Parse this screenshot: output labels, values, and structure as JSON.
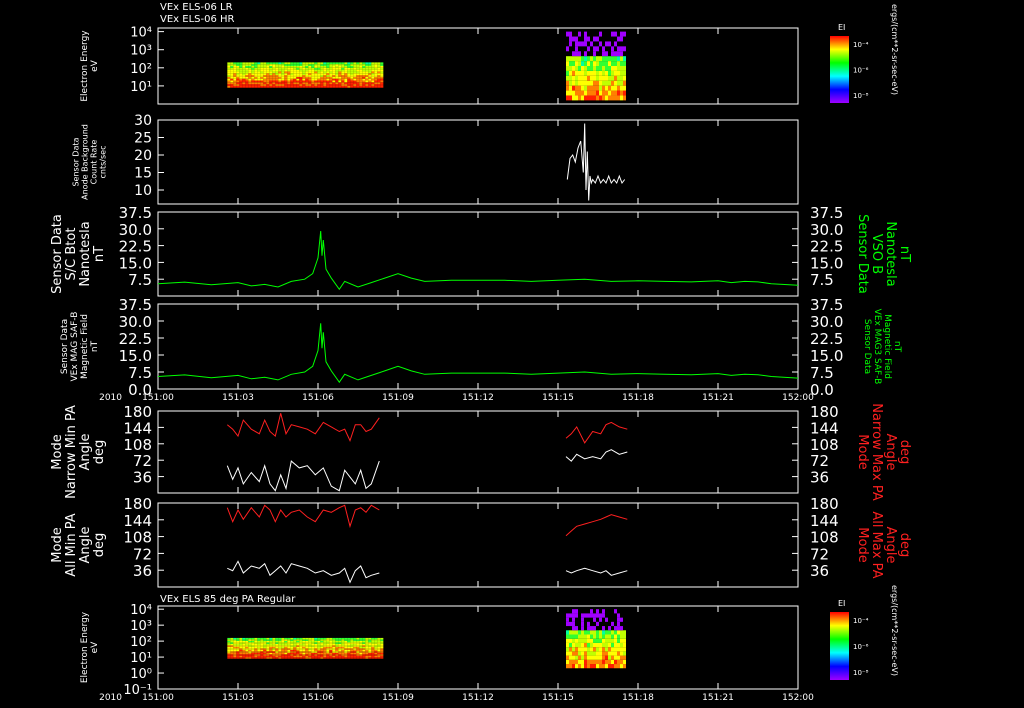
{
  "chart_data": [
    {
      "type": "heatmap",
      "titles": [
        "VEx ELS-06 LR",
        "VEx ELS-06 HR"
      ],
      "ylabel": [
        "Electron Energy",
        "eV"
      ],
      "yscale": "log",
      "ytick_labels": [
        "10⁴",
        "10³",
        "10²",
        "10¹"
      ],
      "ylim_log10": [
        0,
        4.2
      ],
      "colorbar": {
        "title": "EI",
        "ticks": [
          "10⁻⁴",
          "10⁻⁶",
          "10⁻⁸"
        ],
        "unit": "ergs/(cm**2-sr-sec-eV)"
      },
      "data_blocks": [
        {
          "t_start": 2.6,
          "t_end": 8.4,
          "e_log10_range": [
            0.9,
            2.3
          ]
        },
        {
          "t_start": 15.3,
          "t_end": 17.6,
          "e_log10_range": [
            0.2,
            4.0
          ]
        }
      ]
    },
    {
      "type": "line",
      "ylabel": [
        "Sensor Data",
        "Anode Background",
        "Count Rate",
        "cnts/sec"
      ],
      "ylim": [
        6,
        30
      ],
      "yticks": [
        10,
        15,
        20,
        25,
        30
      ],
      "series": [
        {
          "color": "#ffffff",
          "x": [
            15.35,
            15.45,
            15.55,
            15.65,
            15.75,
            15.85,
            15.95,
            16.0,
            16.05,
            16.1,
            16.15,
            16.2,
            16.25,
            16.3,
            16.4,
            16.5,
            16.6,
            16.7,
            16.8,
            16.9,
            17.0,
            17.1,
            17.2,
            17.3,
            17.4,
            17.5
          ],
          "y": [
            13,
            19,
            20,
            18,
            22,
            24,
            15,
            29,
            10,
            21,
            7,
            14,
            12,
            13,
            12,
            14,
            12,
            13,
            12,
            14,
            12,
            13,
            12,
            14,
            12,
            13
          ]
        }
      ]
    },
    {
      "type": "line",
      "ylabel_left": [
        "Sensor Data",
        "S/C Btot",
        "Nanotesla",
        "nT"
      ],
      "ylabel_right": [
        "Sensor Data",
        "VSO B",
        "Nanotesla",
        "nT"
      ],
      "ylim": [
        0,
        37.5
      ],
      "yticks": [
        "37.5",
        "30.0",
        "22.5",
        "15.0",
        "7.5"
      ],
      "series": [
        {
          "color": "#00ff00",
          "x": [
            0,
            1,
            2,
            3,
            3.5,
            4,
            4.5,
            5,
            5.5,
            5.8,
            6.0,
            6.1,
            6.15,
            6.2,
            6.3,
            6.5,
            6.8,
            7.0,
            7.5,
            8,
            8.5,
            9,
            9.5,
            10,
            11,
            12,
            13,
            14,
            15,
            16,
            17,
            18,
            19,
            20,
            21,
            21.5,
            22,
            22.5,
            23,
            24
          ],
          "y": [
            5.5,
            6.2,
            5.0,
            6.0,
            4.5,
            5.2,
            4.0,
            6.5,
            7.5,
            10,
            17,
            29,
            18,
            25,
            12,
            8,
            3,
            6.5,
            4,
            6,
            8,
            10,
            8,
            6.5,
            7,
            7,
            7,
            6.5,
            7,
            7.5,
            6.5,
            6.8,
            6.5,
            6.3,
            6.8,
            6.0,
            6.5,
            6.3,
            5.5,
            4.8
          ]
        }
      ]
    },
    {
      "type": "line",
      "ylabel_left": [
        "Sensor Data",
        "VEx MAG SAF-B",
        "Magnetic Field",
        "nT"
      ],
      "ylabel_right": [
        "Sensor Data",
        "VEx MAG3 SAF-B",
        "Magnetic Field",
        "nT"
      ],
      "ylim": [
        0,
        37.5
      ],
      "yticks": [
        "37.5",
        "30.0",
        "22.5",
        "15.0",
        "7.5",
        "0.0"
      ],
      "series": [
        {
          "color": "#00ff00",
          "x": [
            0,
            1,
            2,
            3,
            3.5,
            4,
            4.5,
            5,
            5.5,
            5.8,
            6.0,
            6.1,
            6.15,
            6.2,
            6.3,
            6.5,
            6.8,
            7.0,
            7.5,
            8,
            8.5,
            9,
            9.5,
            10,
            11,
            12,
            13,
            14,
            15,
            16,
            17,
            18,
            19,
            20,
            21,
            21.5,
            22,
            22.5,
            23,
            24
          ],
          "y": [
            5.5,
            6.2,
            5.0,
            6.0,
            4.5,
            5.2,
            4.0,
            6.5,
            7.5,
            10,
            17,
            29,
            18,
            25,
            12,
            8,
            3,
            6.5,
            4,
            6,
            8,
            10,
            8,
            6.5,
            7,
            7,
            7,
            6.5,
            7,
            7.5,
            6.5,
            6.8,
            6.5,
            6.3,
            6.8,
            6.0,
            6.5,
            6.3,
            5.5,
            4.8
          ]
        }
      ]
    },
    {
      "type": "line",
      "ylabel_left": [
        "Mode",
        "Narrow Min PA",
        "Angle",
        "deg"
      ],
      "ylabel_right": [
        "Mode",
        "Narrow Max PA",
        "Angle",
        "deg"
      ],
      "ylim": [
        0,
        180
      ],
      "yticks": [
        "180",
        "144",
        "108",
        "72",
        "36"
      ],
      "series": [
        {
          "color": "#ff2020",
          "x": [
            2.6,
            2.8,
            3.0,
            3.2,
            3.5,
            3.8,
            4.0,
            4.2,
            4.4,
            4.6,
            4.8,
            5.0,
            5.3,
            5.6,
            5.9,
            6.2,
            6.5,
            6.8,
            7.0,
            7.2,
            7.4,
            7.6,
            7.8,
            8.0,
            8.3
          ],
          "y": [
            150,
            140,
            125,
            160,
            140,
            130,
            160,
            135,
            125,
            175,
            130,
            150,
            145,
            140,
            130,
            155,
            145,
            135,
            140,
            115,
            150,
            150,
            135,
            140,
            165
          ]
        },
        {
          "color": "#ff2020",
          "x": [
            15.3,
            15.5,
            15.7,
            16.0,
            16.3,
            16.6,
            16.8,
            17.0,
            17.3,
            17.6
          ],
          "y": [
            120,
            130,
            145,
            110,
            135,
            130,
            150,
            155,
            145,
            140
          ]
        },
        {
          "color": "#ffffff",
          "x": [
            2.6,
            2.8,
            3.0,
            3.2,
            3.5,
            3.8,
            4.0,
            4.2,
            4.4,
            4.6,
            4.8,
            5.0,
            5.3,
            5.6,
            5.9,
            6.2,
            6.5,
            6.8,
            7.0,
            7.2,
            7.4,
            7.6,
            7.8,
            8.0,
            8.3
          ],
          "y": [
            60,
            30,
            55,
            20,
            45,
            25,
            60,
            20,
            5,
            40,
            10,
            70,
            55,
            60,
            40,
            55,
            15,
            5,
            50,
            35,
            20,
            50,
            10,
            20,
            70
          ]
        },
        {
          "color": "#ffffff",
          "x": [
            15.3,
            15.5,
            15.7,
            16.0,
            16.3,
            16.6,
            16.8,
            17.0,
            17.3,
            17.6
          ],
          "y": [
            80,
            70,
            85,
            75,
            80,
            75,
            90,
            95,
            85,
            90
          ]
        }
      ]
    },
    {
      "type": "line",
      "ylabel_left": [
        "Mode",
        "All Min PA",
        "Angle",
        "deg"
      ],
      "ylabel_right": [
        "Mode",
        "All Max PA",
        "Angle",
        "deg"
      ],
      "ylim": [
        0,
        180
      ],
      "yticks": [
        "180",
        "144",
        "108",
        "72",
        "36"
      ],
      "series": [
        {
          "color": "#ff2020",
          "x": [
            2.6,
            2.8,
            3.0,
            3.2,
            3.5,
            3.8,
            4.0,
            4.2,
            4.4,
            4.6,
            4.8,
            5.0,
            5.3,
            5.6,
            5.9,
            6.2,
            6.5,
            6.8,
            7.0,
            7.2,
            7.4,
            7.6,
            7.8,
            8.0,
            8.3
          ],
          "y": [
            170,
            140,
            165,
            145,
            170,
            150,
            175,
            165,
            140,
            165,
            150,
            160,
            165,
            150,
            140,
            165,
            160,
            170,
            175,
            130,
            165,
            170,
            160,
            175,
            165
          ]
        },
        {
          "color": "#ff2020",
          "x": [
            15.3,
            15.5,
            15.7,
            16.0,
            16.3,
            16.6,
            16.8,
            17.0,
            17.3,
            17.6
          ],
          "y": [
            110,
            120,
            130,
            135,
            140,
            145,
            150,
            155,
            150,
            145
          ]
        },
        {
          "color": "#ffffff",
          "x": [
            2.6,
            2.8,
            3.0,
            3.2,
            3.5,
            3.8,
            4.0,
            4.2,
            4.4,
            4.6,
            4.8,
            5.0,
            5.3,
            5.6,
            5.9,
            6.2,
            6.5,
            6.8,
            7.0,
            7.2,
            7.4,
            7.6,
            7.8,
            8.0,
            8.3
          ],
          "y": [
            40,
            35,
            55,
            30,
            45,
            40,
            50,
            25,
            35,
            45,
            30,
            50,
            45,
            40,
            30,
            35,
            25,
            30,
            40,
            10,
            35,
            45,
            20,
            25,
            30
          ]
        },
        {
          "color": "#ffffff",
          "x": [
            15.3,
            15.5,
            15.7,
            16.0,
            16.3,
            16.6,
            16.8,
            17.0,
            17.3,
            17.6
          ],
          "y": [
            35,
            30,
            35,
            40,
            35,
            30,
            35,
            25,
            30,
            35
          ]
        }
      ]
    },
    {
      "type": "heatmap",
      "titles": [
        "VEx ELS 85 deg PA Regular"
      ],
      "ylabel": [
        "Electron Energy",
        "eV"
      ],
      "yscale": "log",
      "ytick_labels": [
        "10⁴",
        "10³",
        "10²",
        "10¹",
        "10⁰",
        "10⁻¹"
      ],
      "ylim_log10": [
        -1,
        4.2
      ],
      "colorbar": {
        "title": "EI",
        "ticks": [
          "10⁻⁴",
          "10⁻⁶",
          "10⁻⁸"
        ],
        "unit": "ergs/(cm**2-sr-sec-eV)"
      },
      "data_blocks": [
        {
          "t_start": 2.6,
          "t_end": 8.4,
          "e_log10_range": [
            0.9,
            2.2
          ]
        },
        {
          "t_start": 15.3,
          "t_end": 17.6,
          "e_log10_range": [
            0.3,
            4.0
          ]
        }
      ]
    }
  ],
  "xaxis": {
    "year_label": "2010",
    "tick_labels": [
      "151:00",
      "151:03",
      "151:06",
      "151:09",
      "151:12",
      "151:15",
      "151:18",
      "151:21",
      "152:00"
    ],
    "tick_minutes": [
      0,
      3,
      6,
      9,
      12,
      15,
      18,
      21,
      24
    ]
  }
}
